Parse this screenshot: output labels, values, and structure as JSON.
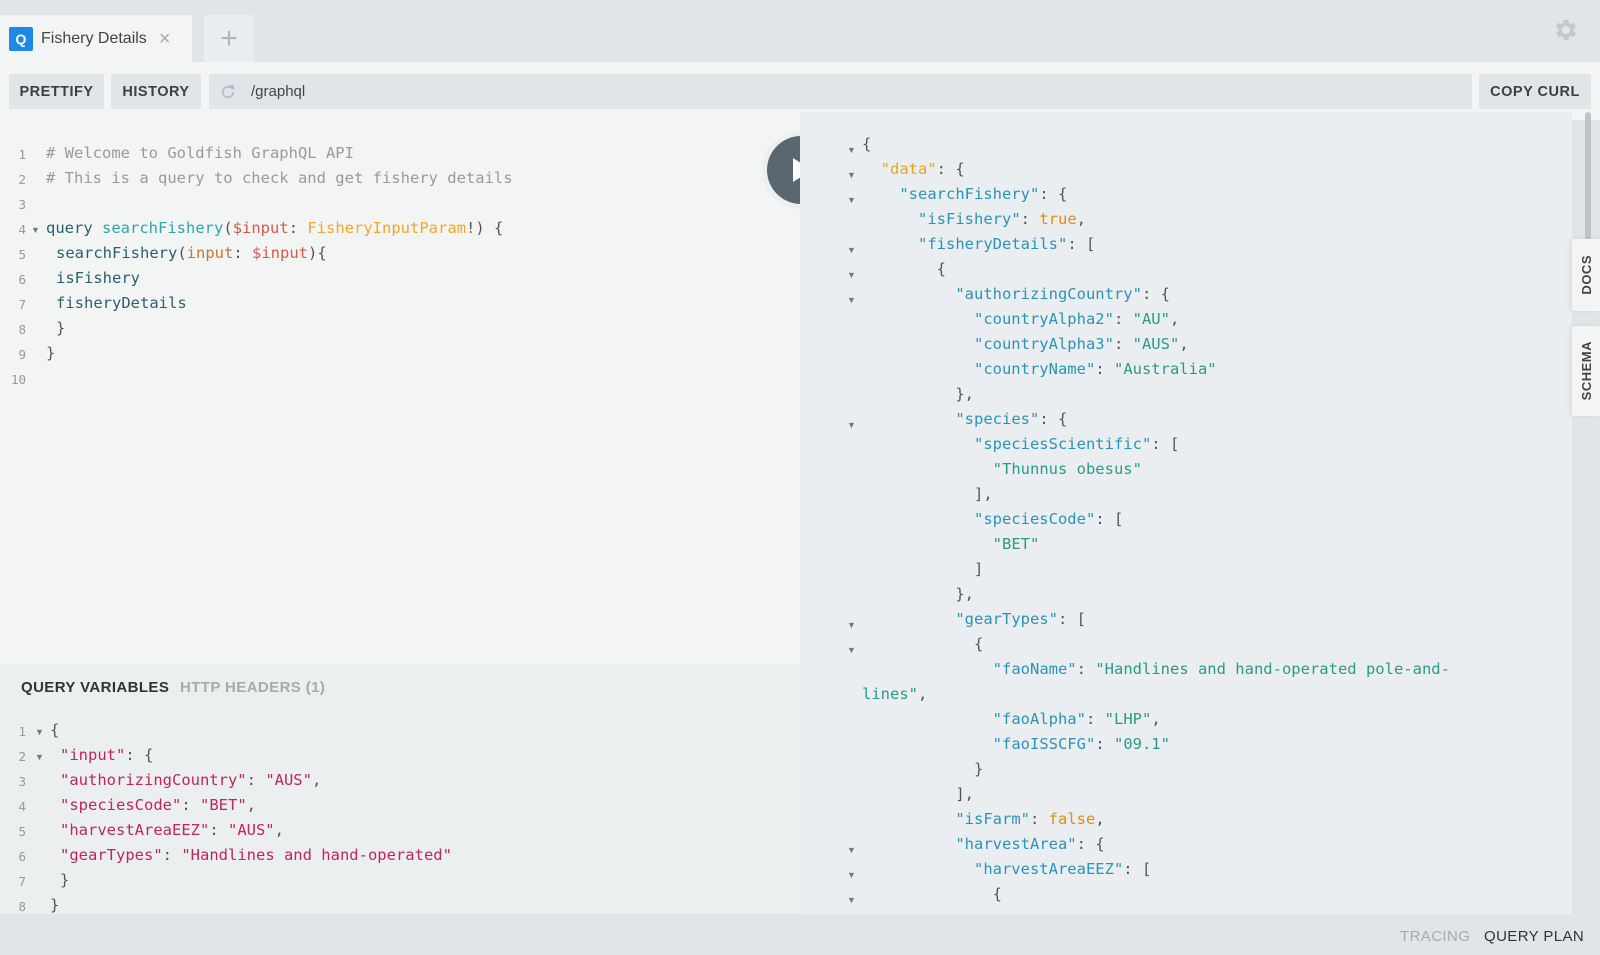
{
  "tabs": [
    {
      "icon_letter": "Q",
      "title": "Fishery Details"
    }
  ],
  "new_tab_label": "+",
  "toolbar": {
    "prettify": "PRETTIFY",
    "history": "HISTORY",
    "endpoint": "/graphql",
    "copy_curl": "COPY CURL"
  },
  "query_lines": [
    "# Welcome to Goldfish GraphQL API",
    "# This is a query to check and get fishery details",
    "",
    "query searchFishery($input: FisheryInputParam!) {",
    "searchFishery(input: $input){",
    "isFishery",
    "fisheryDetails",
    "}",
    "}",
    ""
  ],
  "variables_panel": {
    "tabs": [
      "QUERY VARIABLES",
      "HTTP HEADERS (1)"
    ],
    "lines": [
      "{",
      "\"input\": {",
      "\"authorizingCountry\": \"AUS\",",
      "\"speciesCode\": \"BET\",",
      "\"harvestAreaEEZ\": \"AUS\",",
      "\"gearTypes\": \"Handlines and hand-operated\"",
      "}",
      "}"
    ]
  },
  "result_lines": [
    "{",
    "  \"data\": {",
    "    \"searchFishery\": {",
    "      \"isFishery\": true,",
    "      \"fisheryDetails\": [",
    "        {",
    "          \"authorizingCountry\": {",
    "            \"countryAlpha2\": \"AU\",",
    "            \"countryAlpha3\": \"AUS\",",
    "            \"countryName\": \"Australia\"",
    "          },",
    "          \"species\": {",
    "            \"speciesScientific\": [",
    "              \"Thunnus obesus\"",
    "            ],",
    "            \"speciesCode\": [",
    "              \"BET\"",
    "            ]",
    "          },",
    "          \"gearTypes\": [",
    "            {",
    "              \"faoName\": \"Handlines and hand-operated pole-and-",
    "lines\",",
    "              \"faoAlpha\": \"LHP\",",
    "              \"faoISSCFG\": \"09.1\"",
    "            }",
    "          ],",
    "          \"isFarm\": false,",
    "          \"harvestArea\": {",
    "            \"harvestAreaEEZ\": [",
    "              {"
  ],
  "side_tabs": [
    "DOCS",
    "SCHEMA"
  ],
  "footer": {
    "tracing": "TRACING",
    "query_plan": "QUERY PLAN"
  },
  "colors": {
    "accent": "#1e88e5",
    "run_button": "#5b6770"
  }
}
